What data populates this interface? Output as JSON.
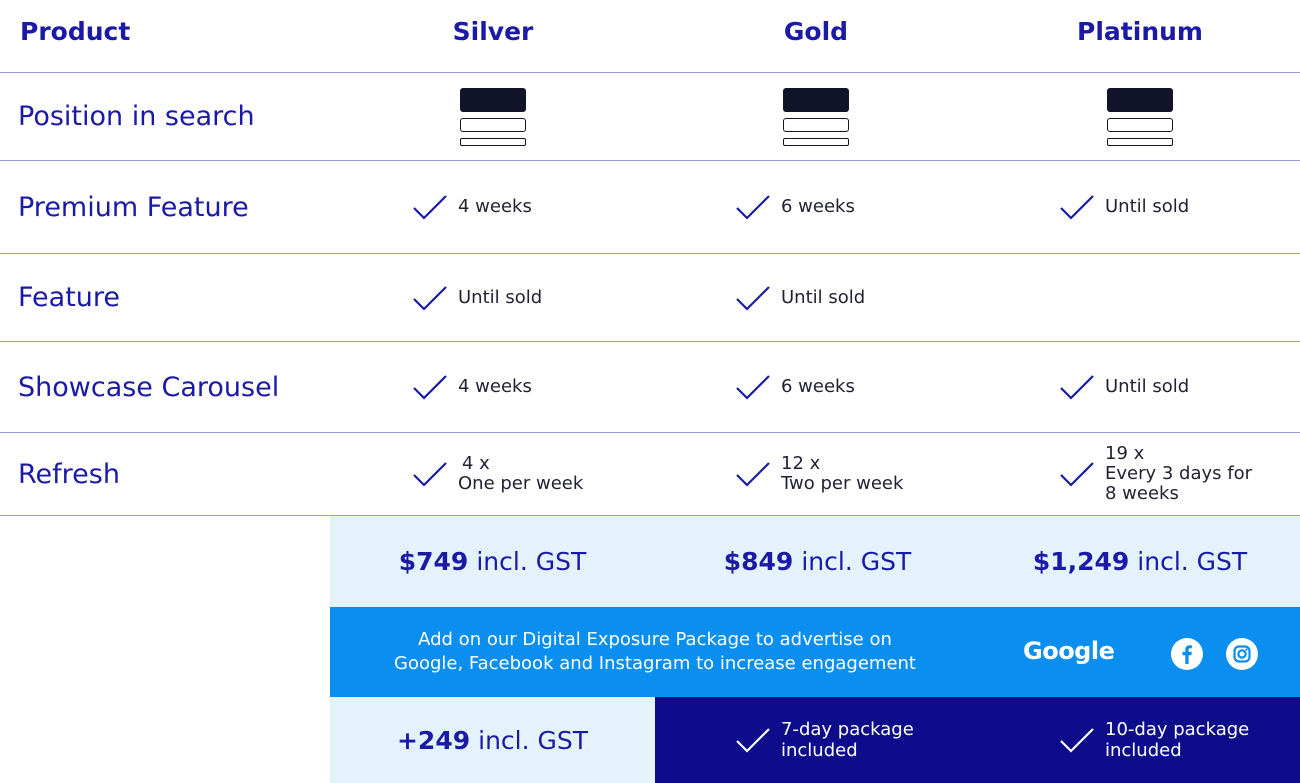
{
  "header": {
    "product": "Product",
    "tiers": [
      "Silver",
      "Gold",
      "Platinum"
    ]
  },
  "rows": [
    {
      "label": "Position in search"
    },
    {
      "label": "Premium Feature",
      "silver": "4 weeks",
      "gold": "6 weeks",
      "platinum": "Until sold"
    },
    {
      "label": "Feature",
      "silver": "Until sold",
      "gold": "Until sold"
    },
    {
      "label": "Showcase Carousel",
      "silver": "4 weeks",
      "gold": "6 weeks",
      "platinum": "Until sold"
    },
    {
      "label": "Refresh",
      "silver": {
        "line1": "4 x",
        "line2": "One per week"
      },
      "gold": {
        "line1": "12 x",
        "line2": "Two per week"
      },
      "platinum": {
        "line1": "19 x",
        "line2": "Every 3 days for",
        "line3": "8 weeks"
      }
    }
  ],
  "prices": {
    "silver": {
      "amount": "$749",
      "suffix": "incl. GST"
    },
    "gold": {
      "amount": "$849",
      "suffix": "incl. GST"
    },
    "platinum": {
      "amount": "$1,249",
      "suffix": "incl. GST"
    }
  },
  "digital": {
    "line1": "Add on our Digital Exposure Package to advertise on",
    "line2": "Google, Facebook and Instagram to increase engagement",
    "google_label": "Google",
    "icons": [
      "facebook-icon",
      "instagram-icon"
    ]
  },
  "addon": {
    "amount": "+249",
    "suffix": "incl. GST",
    "gold": {
      "line1": "7-day package",
      "line2": "included"
    },
    "platinum": {
      "line1": "10-day package",
      "line2": "included"
    }
  },
  "colors": {
    "primary": "#1a1aa6",
    "light_band": "#e4f2fb",
    "blue_band": "#0a8ff0",
    "dark_band": "#0d0d8c"
  }
}
